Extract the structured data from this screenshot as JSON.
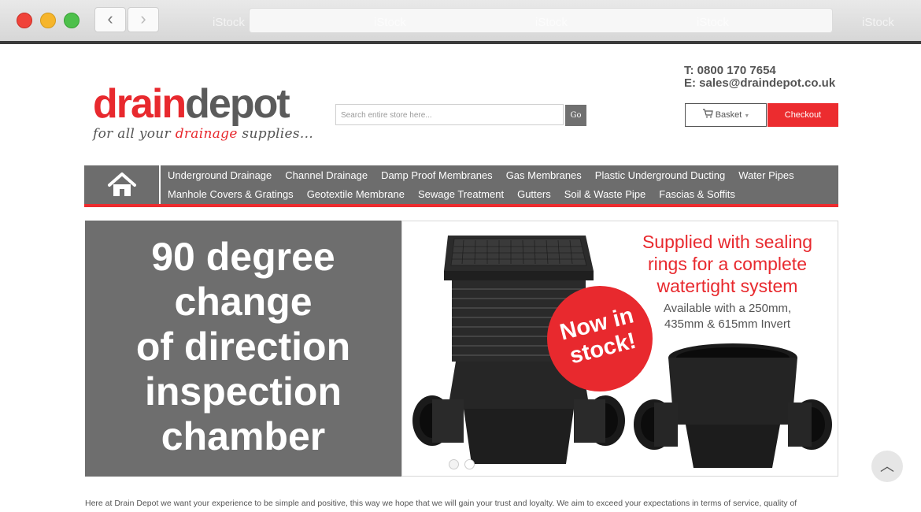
{
  "browser": {
    "back_glyph": "‹",
    "forward_glyph": "›",
    "watermark": "iStock"
  },
  "header": {
    "logo_drain": "drain",
    "logo_depot": "depot",
    "tagline_pre": "for all your ",
    "tagline_accent": "drainage",
    "tagline_post": " supplies...",
    "search_placeholder": "Search entire store here...",
    "search_button": "Go",
    "phone": "T: 0800 170 7654",
    "email": "E: sales@draindepot.co.uk",
    "basket_label": "Basket",
    "checkout_label": "Checkout"
  },
  "nav": {
    "row1": [
      "Underground Drainage",
      "Channel Drainage",
      "Damp Proof Membranes",
      "Gas Membranes",
      "Plastic Underground Ducting",
      "Water Pipes"
    ],
    "row2": [
      "Manhole Covers & Gratings",
      "Geotextile Membrane",
      "Sewage Treatment",
      "Gutters",
      "Soil & Waste Pipe",
      "Fascias & Soffits"
    ]
  },
  "banner": {
    "headline_lines": [
      "90 degree",
      "change",
      "of direction",
      "inspection",
      "chamber"
    ],
    "supplied_lines": [
      "Supplied with sealing",
      "rings for a complete",
      "watertight system"
    ],
    "available_lines": [
      "Available with a 250mm,",
      "435mm & 615mm Invert"
    ],
    "badge_lines": [
      "Now in",
      "stock!"
    ]
  },
  "intro": {
    "text": "Here at Drain Depot we want your experience to be simple and positive, this way we hope that we will gain your trust and loyalty. We aim to exceed your expectations in terms of service, quality of"
  },
  "colors": {
    "brand_red": "#e8292e",
    "nav_grey": "#6d6d6d",
    "banner_grey": "#6e6e6e"
  }
}
